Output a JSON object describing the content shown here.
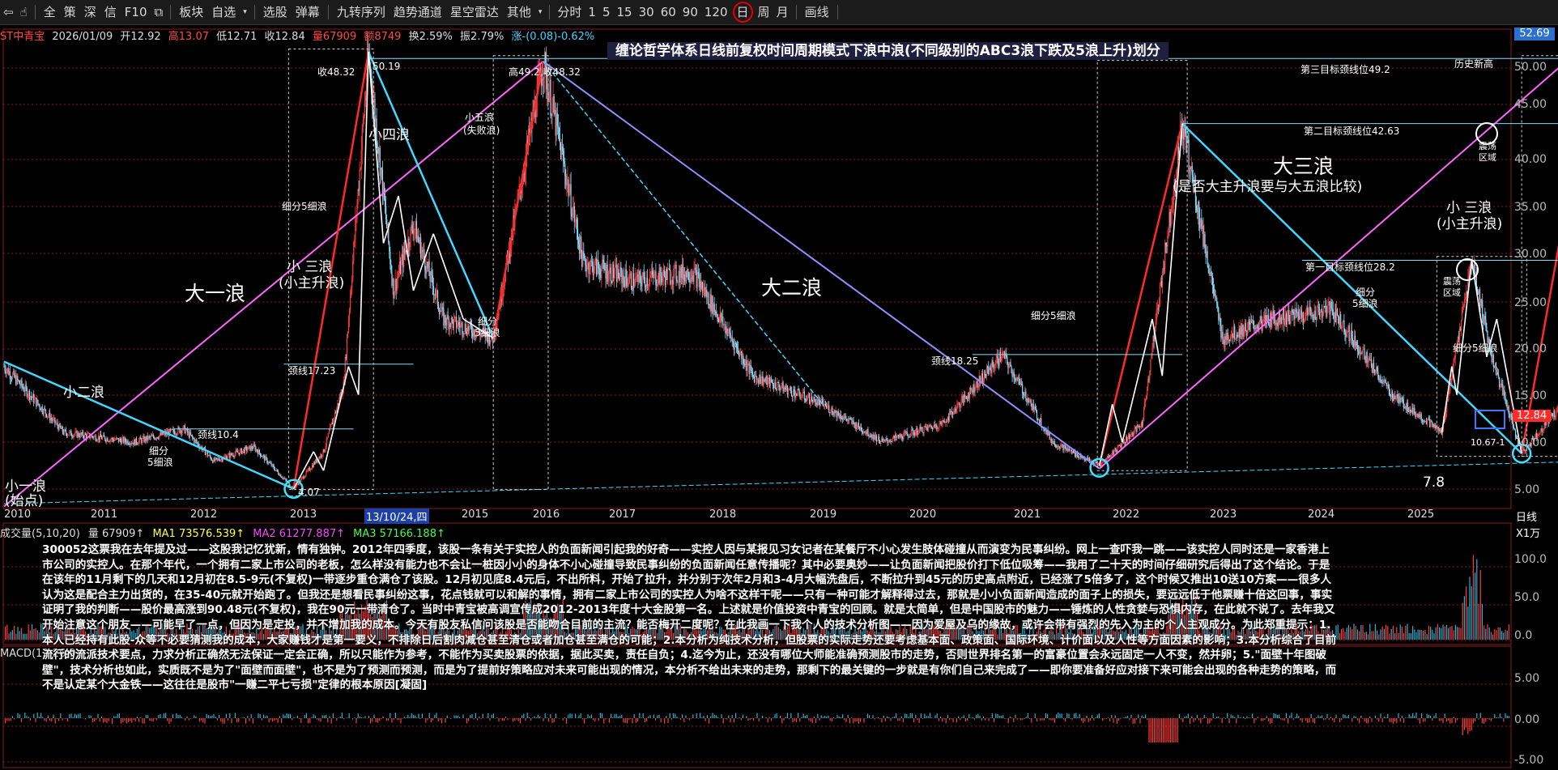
{
  "toolbar": {
    "full_label": "全",
    "policy_label": "策",
    "depth_label": "深",
    "info_label": "信",
    "f10_label": "F10",
    "plate_label": "板块",
    "watch_label": "自选",
    "pick_label": "选股",
    "popup_label": "弹幕",
    "nine_label": "九转序列",
    "trend_label": "趋势通道",
    "radar_label": "星空雷达",
    "other_label": "其他",
    "periods": [
      "分时",
      "1",
      "5",
      "15",
      "30",
      "60",
      "90",
      "120",
      "日",
      "周",
      "月"
    ],
    "draw_label": "画线"
  },
  "info": {
    "name": "ST中青宝",
    "date": "2026/01/09",
    "open": "开12.92",
    "high": "高13.07",
    "low": "低12.71",
    "close": "收12.84",
    "volume": "量67909",
    "amount": "额8749",
    "turnover": "换2.59%",
    "amplitude": "振2.79%",
    "change": "涨-(0.08)-0.62%"
  },
  "title": "缠论哲学体系日线前复权时间周期模式下浪中浪(不同级别的ABC3浪下跌及5浪上升)划分",
  "price_tag": "52.69",
  "last_price": "12.84",
  "yaxis": [
    "50.00",
    "45.00",
    "40.00",
    "35.00",
    "30.00",
    "25.00",
    "20.00",
    "15.00",
    "10.00",
    "5.00"
  ],
  "xaxis": [
    "2010",
    "2011",
    "2012",
    "2013",
    "13/10/24,四",
    "2015",
    "2016",
    "2017",
    "2018",
    "2019",
    "2020",
    "2021",
    "2022",
    "2023",
    "2024",
    "2025"
  ],
  "day_tab": "日线",
  "x1_tab": "X1万",
  "vol": {
    "label": "成交量(5,10,20)",
    "v": "量 67909↑",
    "ma1": "MA1 73576.539↑",
    "ma2": "MA2 61277.887↑",
    "ma3": "MA3 57166.188↑"
  },
  "vol_axis": [
    "100.0",
    "50.0",
    "0.0"
  ],
  "macd": {
    "label": "MACD(12,26,9)"
  },
  "macd_axis": [
    "5.00",
    "0.00",
    "-5.00"
  ],
  "ann": {
    "big1": "大一浪",
    "big2": "大二浪",
    "big3": "大三浪",
    "big3b": "(是否大主升浪要与大五浪比较)",
    "small1": "小一浪",
    "small1b": "(始点)",
    "small2": "小二浪",
    "small3": "小 三浪",
    "small3b": "(小主升浪)",
    "small4": "小四浪",
    "small5": "小五浪",
    "small5b": "(失败浪)",
    "small3r": "小 三浪",
    "small3rb": "(小主升浪)",
    "sub5a": "细分5细浪",
    "sub5b": "细分",
    "sub5c": "5细浪",
    "sub5d": "细分",
    "sub5e": "5细浪",
    "sub5f": "细分5细浪",
    "sub5g": "细分",
    "sub5h": "5细浪",
    "sub5i": "细分5细浪",
    "sub5j": "细分",
    "sub5k": "5细浪",
    "neck1": "颈线10.4",
    "neck2": "颈线17.23",
    "neck3": "颈线18.25",
    "close1": "收48.32",
    "high1": "50.19",
    "high2": "高49.2,收48.32",
    "low1": "4.07",
    "low2": "7.8",
    "target3": "第三目标颈线位49.2",
    "target2": "第二目标颈线位42.63",
    "target1": "第一目标颈线位28.2",
    "hist_high": "历史新高",
    "osc1": "震荡区域",
    "osc1a": "震荡",
    "osc1b": "区域",
    "osc2a": "震荡",
    "osc2b": "区域",
    "range": "10.67-1"
  },
  "note": "300052这票我在去年提及过——这股我记忆犹新，情有独钟。2012年四季度，该股一条有关于实控人的负面新闻引起我的好奇——实控人因与某报见习女记者在某餐厅不小心发生肢体碰撞从而演变为民事纠纷。网上一查吓我一跳——该实控人同时还是一家香港上市公司的实控人。在那个年代，一个拥有二家上市公司的老板，怎么样没有能力也不会让一桩因小小的身体不小心碰撞导致民事纠纷的负面新闻任意传播呢？其中必要奥妙——让负面新闻把股价打下低位吸筹——我用了二十天的时间仔细研究后得出了这个结论。于是在该年的11月剩下的几天和12月初在8.5-9元(不复权)一带逐步重仓满仓了该股。12月初见底8.4元后，不出所料，开始了拉升，并分别于次年2月和3-4月大幅洗盘后，不断拉升到45元的历史高点附近，已经涨了5倍多了，这个时候又推出10送10方案——很多人认为这是配合主力出货的，在35-40元就开始跑了。但我还是想看民事纠纷这事，花点钱就可以和解的事情，拥有二家上市公司的实控人为啥不这样干呢——只有一种可能才解释得过去，那就是小小负面新闻造成的面子上的损失，要远远低于他票赚十倍这回事，事实证明了我的判断——股价最高涨到90.48元(不复权)，我在90元一带清仓了。当时中青宝被高调宣传成2012-2013年度十大金股第一名。上述就是价值投资中青宝的回顾。就是太简单，但是中国股市的魅力——锤炼的人性贪婪与恐惧内存，在此就不说了。去年我又开始注意这个朋友——可能早了一点，但因为是定投，并不增加我的成本。今天有股友私信问该股是否能吻合目前的主流？能否梅开二度呢？在此我画一下我个人的技术分析图——因为爱屋及乌的缘故，或许会带有强烈的先入为主的个人主观成分。为此郑重提示：1.本人已经持有此股-众等不必要猜测我的成本，大家赚钱才是第一要义，不排除日后割肉减仓甚至清仓或者加仓甚至满仓的可能；2.本分析为纯技术分析，但股票的实际走势还要考虑基本面、政策面、国际环境、计价面以及人性等方面因素的影响；3.本分析综合了目前流行的流派技术要点，力求分析正确然无法保证一定会正确，所以只能作为参考，不能作为买卖股票的依据，据此买卖，责任自负；4.迄今为止，还没有哪位大师能准确预测股市的走势，否则世界排名第一的富豪位置会永远固定一人不变，然并卵；5.\"面壁十年图破壁\"，技术分析也如此，实质既不是为了\"面壁而面壁\"，也不是为了预测而预测，而是为了提前好策略应对未来可能出现的情况，本分析不给出未来的走势，那剩下的最关键的一步就是有你们自己来完成了——即你要准备好应对接下来可能会出现的各种走势的策略，而不是认定某个大金铁——这往往是股市\"一赚二平七亏损\"定律的根本原因[凝固]",
  "colors": {
    "candle_up": "#ff3c3c",
    "candle_down": "#7fe0ff",
    "neckline": "#7fdfff",
    "magenta": "#ff66ff",
    "purple": "#9090ff",
    "red": "#ff2a2a",
    "white": "#ffffff",
    "axis": "#8a1a1a"
  }
}
